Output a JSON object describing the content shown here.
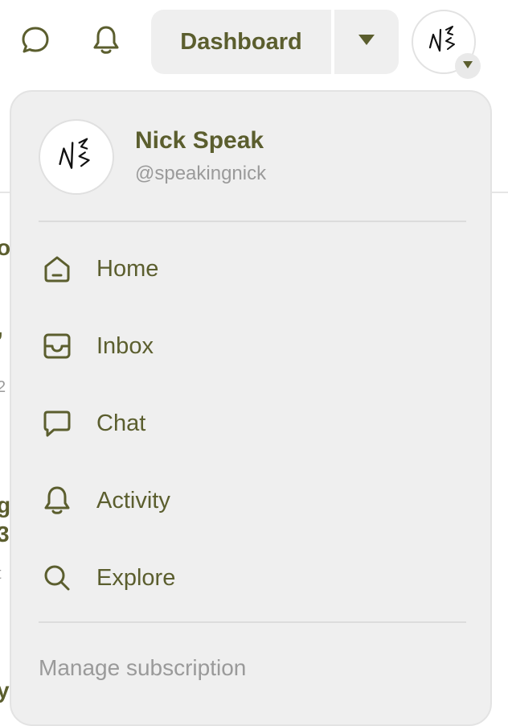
{
  "header": {
    "dashboard_label": "Dashboard",
    "icons": [
      "chat-bubble-icon",
      "bell-icon",
      "caret-down-icon",
      "avatar"
    ]
  },
  "background_fragments": [
    "o",
    ",",
    "2",
    "g",
    "3",
    "t",
    "y"
  ],
  "user": {
    "name": "Nick Speak",
    "handle": "@speakingnick"
  },
  "menu": {
    "items": [
      {
        "label": "Home",
        "icon": "home-icon"
      },
      {
        "label": "Inbox",
        "icon": "inbox-icon"
      },
      {
        "label": "Chat",
        "icon": "chat-icon"
      },
      {
        "label": "Activity",
        "icon": "bell-icon"
      },
      {
        "label": "Explore",
        "icon": "search-icon"
      }
    ],
    "manage_label": "Manage subscription"
  },
  "colors": {
    "accent": "#5b5e2e",
    "menu_bg": "#efefef",
    "muted_text": "#9a9a9a"
  }
}
